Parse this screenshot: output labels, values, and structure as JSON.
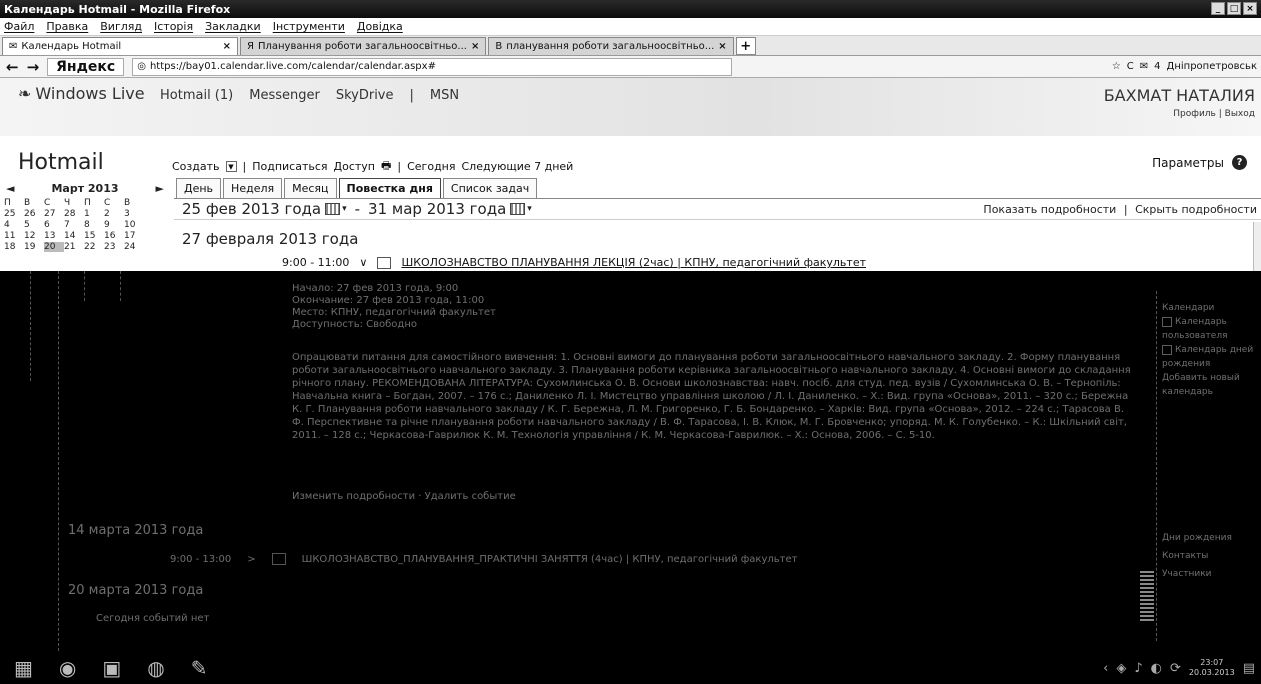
{
  "window": {
    "title": "Календарь Hotmail - Mozilla Firefox",
    "controls": [
      "_",
      "□",
      "×"
    ]
  },
  "menu": [
    "Файл",
    "Правка",
    "Вигляд",
    "Історія",
    "Закладки",
    "Інструменти",
    "Довідка"
  ],
  "tabs": [
    {
      "label": "Календарь Hotmail",
      "close": "×"
    },
    {
      "label": "Планування роботи загальноосвітньо...",
      "close": "×"
    },
    {
      "label": "планування роботи загальноосвітньо...",
      "close": "×"
    }
  ],
  "new_tab": "+",
  "nav": {
    "back": "←",
    "forward": "→",
    "search_engine": "Яндекс",
    "url": "https://bay01.calendar.live.com/calendar/calendar.aspx#",
    "reload": "C",
    "mail_count": "4",
    "weather": "Днiпропетровськ"
  },
  "live": {
    "logo": "Windows Live",
    "nav": [
      "Hotmail (1)",
      "Messenger",
      "SkyDrive",
      "|",
      "MSN"
    ],
    "user": "БАХМАТ НАТАЛИЯ",
    "profile": "Профиль",
    "sep": "|",
    "logout": "Выход"
  },
  "hotmail": {
    "title": "Hotmail",
    "toolbar": {
      "create": "Создать",
      "subscribe": "Подписаться",
      "access": "Доступ",
      "today": "Сегодня",
      "next7": "Следующие 7 дней"
    },
    "params": "Параметры",
    "view_tabs": [
      "День",
      "Неделя",
      "Месяц",
      "Повестка дня",
      "Список задач"
    ],
    "range_start": "25 фев 2013 года",
    "range_sep": "-",
    "range_end": "31 мар 2013 года",
    "show_details": "Показать подробности",
    "details_sep": "|",
    "hide_details": "Скрыть подробности"
  },
  "mini_calendar": {
    "month": "Март 2013",
    "prev": "◄",
    "next": "►",
    "weekdays": [
      "П",
      "В",
      "С",
      "Ч",
      "П",
      "С",
      "В"
    ],
    "days": [
      [
        "25",
        "26",
        "27",
        "28",
        "1",
        "2",
        "3"
      ],
      [
        "4",
        "5",
        "6",
        "7",
        "8",
        "9",
        "10"
      ],
      [
        "11",
        "12",
        "13",
        "14",
        "15",
        "16",
        "17"
      ],
      [
        "18",
        "19",
        "20",
        "21",
        "22",
        "23",
        "24"
      ]
    ],
    "today": "20"
  },
  "agenda": {
    "date1": "27 февраля 2013 года",
    "event1": {
      "time": "9:00 - 11:00",
      "title": "ШКОЛОЗНАВСТВО ПЛАНУВАННЯ ЛЕКЦІЯ (2час) | КПНУ, педагогічний факультет"
    },
    "meta": [
      "Начало: 27 фев 2013 года, 9:00",
      "Окончание: 27 фев 2013 года, 11:00",
      "Место: КПНУ, педагогічний факультет",
      "Доступность: Свободно"
    ],
    "description": "Опрацювати питання для самостійного вивчення: 1. Основні вимоги до планування роботи загальноосвітнього навчального закладу. 2. Форму планування роботи загальноосвітнього навчального закладу. 3. Планування роботи керівника загальноосвітнього навчального закладу. 4. Основні вимоги до складання річного плану. РЕКОМЕНДОВАНА ЛІТЕРАТУРА: Сухомлинська О. В. Основи школознавства: навч. посіб. для студ. пед. вузів / Сухомлинська О. В. – Тернопіль: Навчальна книга – Богдан, 2007. – 176 с.; Даниленко Л. І. Мистецтво управління школою / Л. І. Даниленко. – Х.: Вид. група «Основа», 2011. – 320 с.; Бережна К. Г. Планування роботи навчального закладу / К. Г. Бережна, Л. М. Григоренко, Г. Б. Бондаренко. – Харків: Вид. група «Основа», 2012. – 224 с.; Тарасова В. Ф. Перспективне та річне планування роботи навчального закладу / В. Ф. Тарасова, І. В. Клюк, М. Г. Бровченко; упоряд. М. К. Голубенко. – К.: Шкільний світ, 2011. – 128 с.; Черкасова-Гаврилюк К. М. Технологія управління / К. М. Черкасова-Гаврилюк. – Х.: Основа, 2006. – С. 5-10.",
    "desc_links": "Изменить подробности · Удалить событие",
    "date2": "14 марта 2013 года",
    "event2": {
      "time": "9:00 - 13:00",
      "title": "ШКОЛОЗНАВСТВО_ПЛАНУВАННЯ_ПРАКТИЧНІ ЗАНЯТТЯ (4час) | КПНУ, педагогічний факультет"
    },
    "date3": "20 марта 2013 года",
    "no_events": "Сегодня событий нет"
  },
  "right_panel": {
    "title": "Календари",
    "items": [
      "Календарь пользователя",
      "Календарь дней рождения"
    ],
    "add": "Добавить новый календарь",
    "links": [
      "Дни рождения",
      "Контакты",
      "Участники"
    ]
  },
  "taskbar": {
    "time": "23:07",
    "date": "20.03.2013"
  }
}
